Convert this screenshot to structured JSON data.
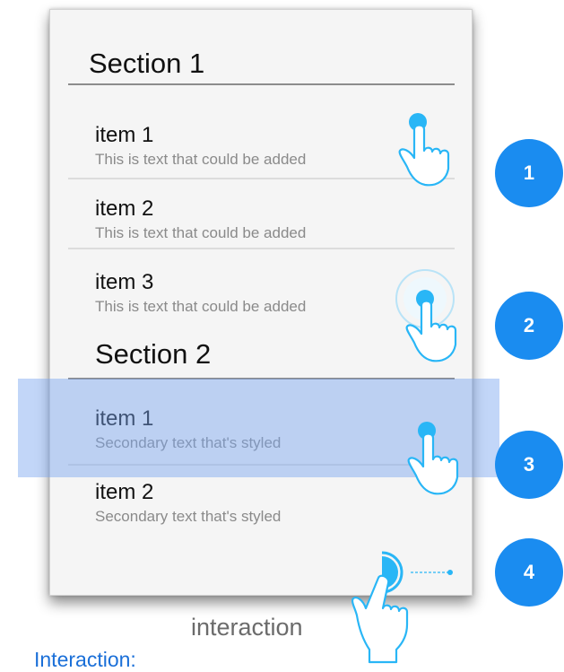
{
  "sections": [
    {
      "title": "Section 1",
      "items": [
        {
          "title": "item 1",
          "subtitle": "This is text that could be added"
        },
        {
          "title": "item 2",
          "subtitle": "This is text that could be added"
        },
        {
          "title": "item 3",
          "subtitle": "This is text that could be added"
        }
      ]
    },
    {
      "title": "Section 2",
      "items": [
        {
          "title": "item 1",
          "subtitle": "Secondary text that's styled"
        },
        {
          "title": "item 2",
          "subtitle": "Secondary text that's styled"
        }
      ]
    }
  ],
  "steps": [
    "1",
    "2",
    "3",
    "4"
  ],
  "caption": "interaction",
  "footer_link": "Interaction:",
  "colors": {
    "accent_blue": "#1a8cf0",
    "touch_blue": "#29b6f6",
    "highlight": "#78a5f0"
  },
  "icons": [
    "touch-hand-icon",
    "touch-dot-icon",
    "ripple-icon"
  ]
}
